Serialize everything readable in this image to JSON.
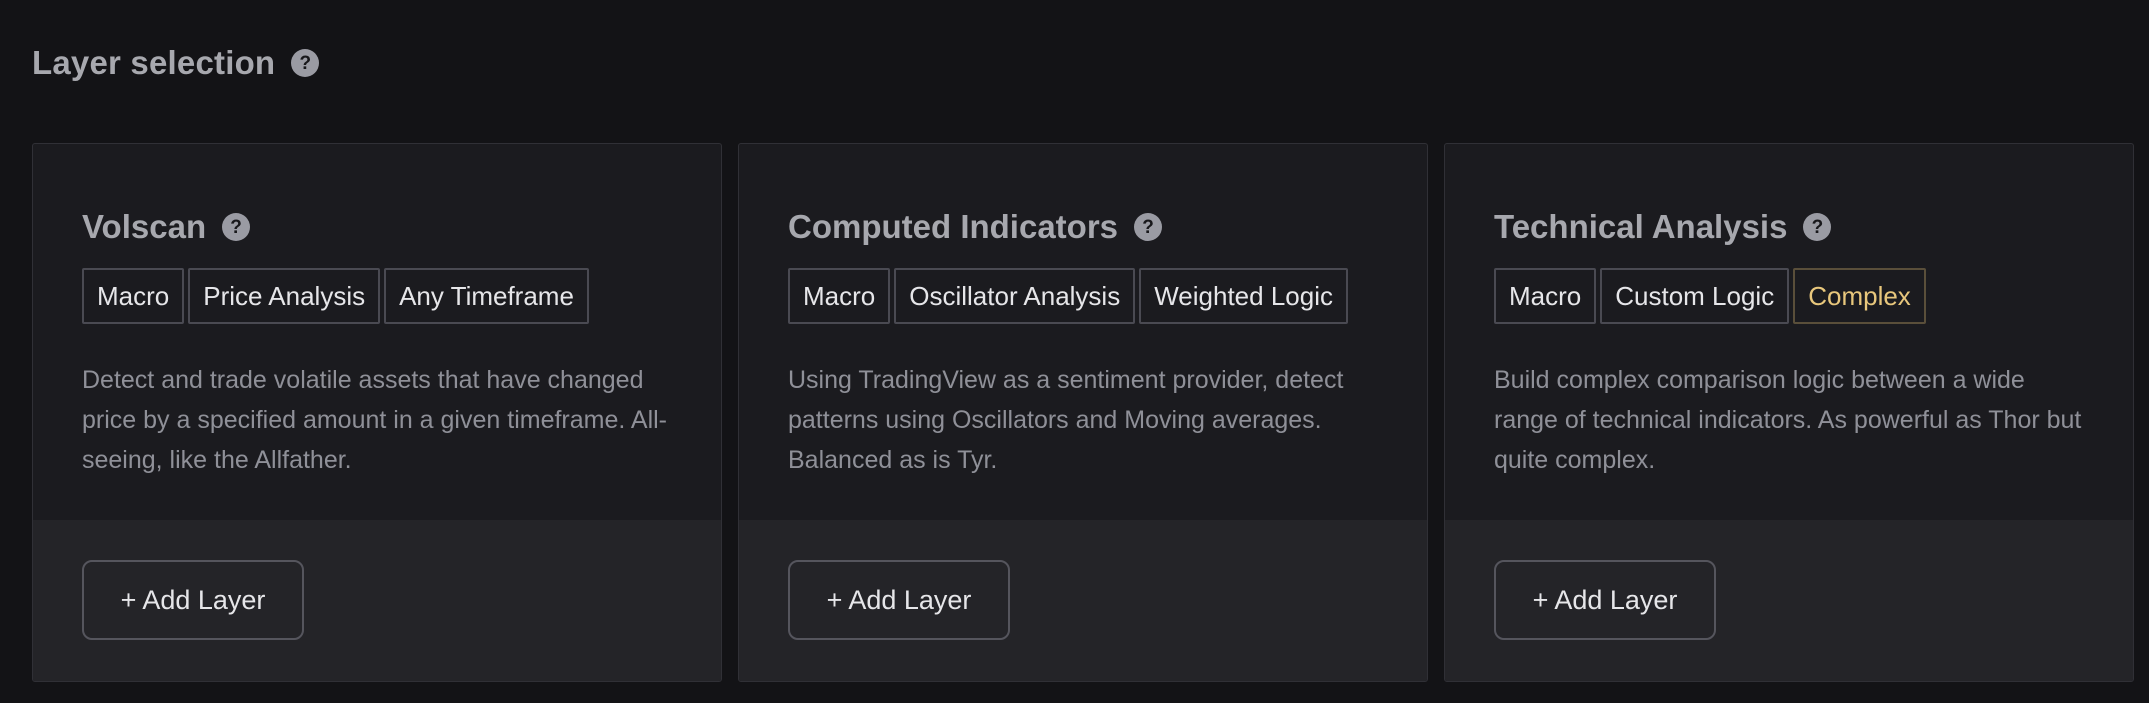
{
  "header": {
    "title": "Layer selection",
    "help_icon": "question-circle-icon"
  },
  "colors": {
    "background": "#131316",
    "card": "#1b1b1f",
    "card_footer": "#242428",
    "complex_tag": "#e8c77c"
  },
  "cards": [
    {
      "title": "Volscan",
      "tags": [
        "Macro",
        "Price Analysis",
        "Any Timeframe"
      ],
      "description": "Detect and trade volatile assets that have changed price by a specified amount in a given timeframe. All-seeing, like the Allfather.",
      "button_label": "+ Add Layer"
    },
    {
      "title": "Computed Indicators",
      "tags": [
        "Macro",
        "Oscillator Analysis",
        "Weighted Logic"
      ],
      "description": "Using TradingView as a sentiment provider, detect patterns using Oscillators and Moving averages. Balanced as is Tyr.",
      "button_label": "+ Add Layer"
    },
    {
      "title": "Technical Analysis",
      "tags": [
        "Macro",
        "Custom Logic",
        "Complex"
      ],
      "description": "Build complex comparison logic between a wide range of technical indicators. As powerful as Thor but quite complex.",
      "button_label": "+ Add Layer"
    }
  ]
}
